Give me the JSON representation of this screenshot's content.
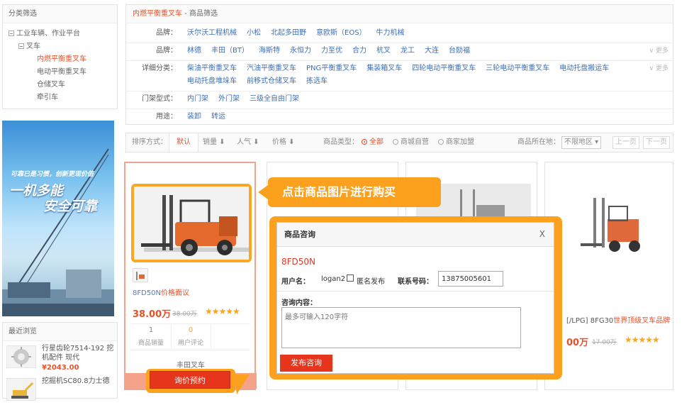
{
  "left": {
    "category_title": "分类筛选",
    "tree": [
      {
        "label": "工业车辆、作业平台",
        "level": 0,
        "box": true
      },
      {
        "label": "叉车",
        "level": 1,
        "box": true
      },
      {
        "label": "内燃平衡重叉车",
        "level": 2,
        "active": true
      },
      {
        "label": "电动平衡重叉车",
        "level": 2
      },
      {
        "label": "仓储叉车",
        "level": 2
      },
      {
        "label": "牵引车",
        "level": 2
      }
    ],
    "banner_line1": "可靠已是习惯，创新更现价值",
    "banner_line2": "一机多能",
    "banner_line3": "安全可靠",
    "recent_title": "最近浏览",
    "recent": [
      {
        "name": "行星齿轮7514-192 挖机配件 现代",
        "price": "¥2043.00"
      },
      {
        "name": "挖掘机SC80.8力士德",
        "price": ""
      }
    ]
  },
  "breadcrumb": {
    "current": "内燃平衡重叉车",
    "separator": " - ",
    "page": "商品筛选"
  },
  "filters": [
    {
      "label": "品牌：",
      "options": [
        "沃尔沃工程机械",
        "小松",
        "北起多田野",
        "意欧斯（EOS）",
        "牛力机械"
      ],
      "more": ""
    },
    {
      "label": "品牌：",
      "options": [
        "林德",
        "丰田（BT）",
        "海斯特",
        "永恒力",
        "力至优",
        "合力",
        "杭叉",
        "龙工",
        "大连",
        "台励福"
      ],
      "more": "更多"
    },
    {
      "label": "详细分类：",
      "options": [
        "柴油平衡重叉车",
        "汽油平衡重叉车",
        "PNG平衡重叉车",
        "集装箱叉车",
        "四轮电动平衡重叉车",
        "三轮电动平衡重叉车",
        "电动托盘搬运车"
      ],
      "options2": [
        "电动托盘堆垛车",
        "前移式仓储叉车",
        "拣选车"
      ],
      "more": "更多"
    },
    {
      "label": "门架型式：",
      "options": [
        "内门架",
        "外门架",
        "三级全自由门架"
      ],
      "more": ""
    },
    {
      "label": "用途：",
      "options": [
        "装卸",
        "转运"
      ],
      "more": ""
    }
  ],
  "sortbar": {
    "label": "排序方式：",
    "default": "默认",
    "sales": "销量",
    "popularity": "人气",
    "price": "价格",
    "type_label": "商品类型：",
    "type_all": "全部",
    "type_self": "商城自营",
    "type_merchant": "商家加盟",
    "location_label": "商品所在地：",
    "location_value": "不限地区",
    "prev": "上一页",
    "next": "下一页"
  },
  "card1": {
    "title": "8FD50N",
    "title_suffix": "价格面议",
    "price": "38.00万",
    "old_price": "38.00万",
    "sales_count": "1",
    "sales_label": "商品销量",
    "reviews_count": "0",
    "reviews_label": "用户评论",
    "shop": "丰田叉车",
    "ask_button": "询价预约"
  },
  "card4": {
    "title_prefix": "[/LPG] 8FG30",
    "title_suffix": "世界顶级叉车品牌",
    "price": "00万",
    "old_price": "17.00万"
  },
  "tip": "点击商品图片进行购买",
  "dialog": {
    "title": "商品咨询",
    "close": "X",
    "product": "8FD50N",
    "user_label": "用户名：",
    "user_value": "logan2",
    "anon_label": "匿名发布",
    "phone_label": "联系号码：",
    "phone_value": "13875005601",
    "content_label": "咨询内容：",
    "content_placeholder": "最多可输入120字符",
    "submit": "发布咨询"
  },
  "colors": {
    "accent": "#e8512a",
    "link": "#3b6fb6",
    "callout": "#fba11e",
    "button": "#e6351c"
  }
}
